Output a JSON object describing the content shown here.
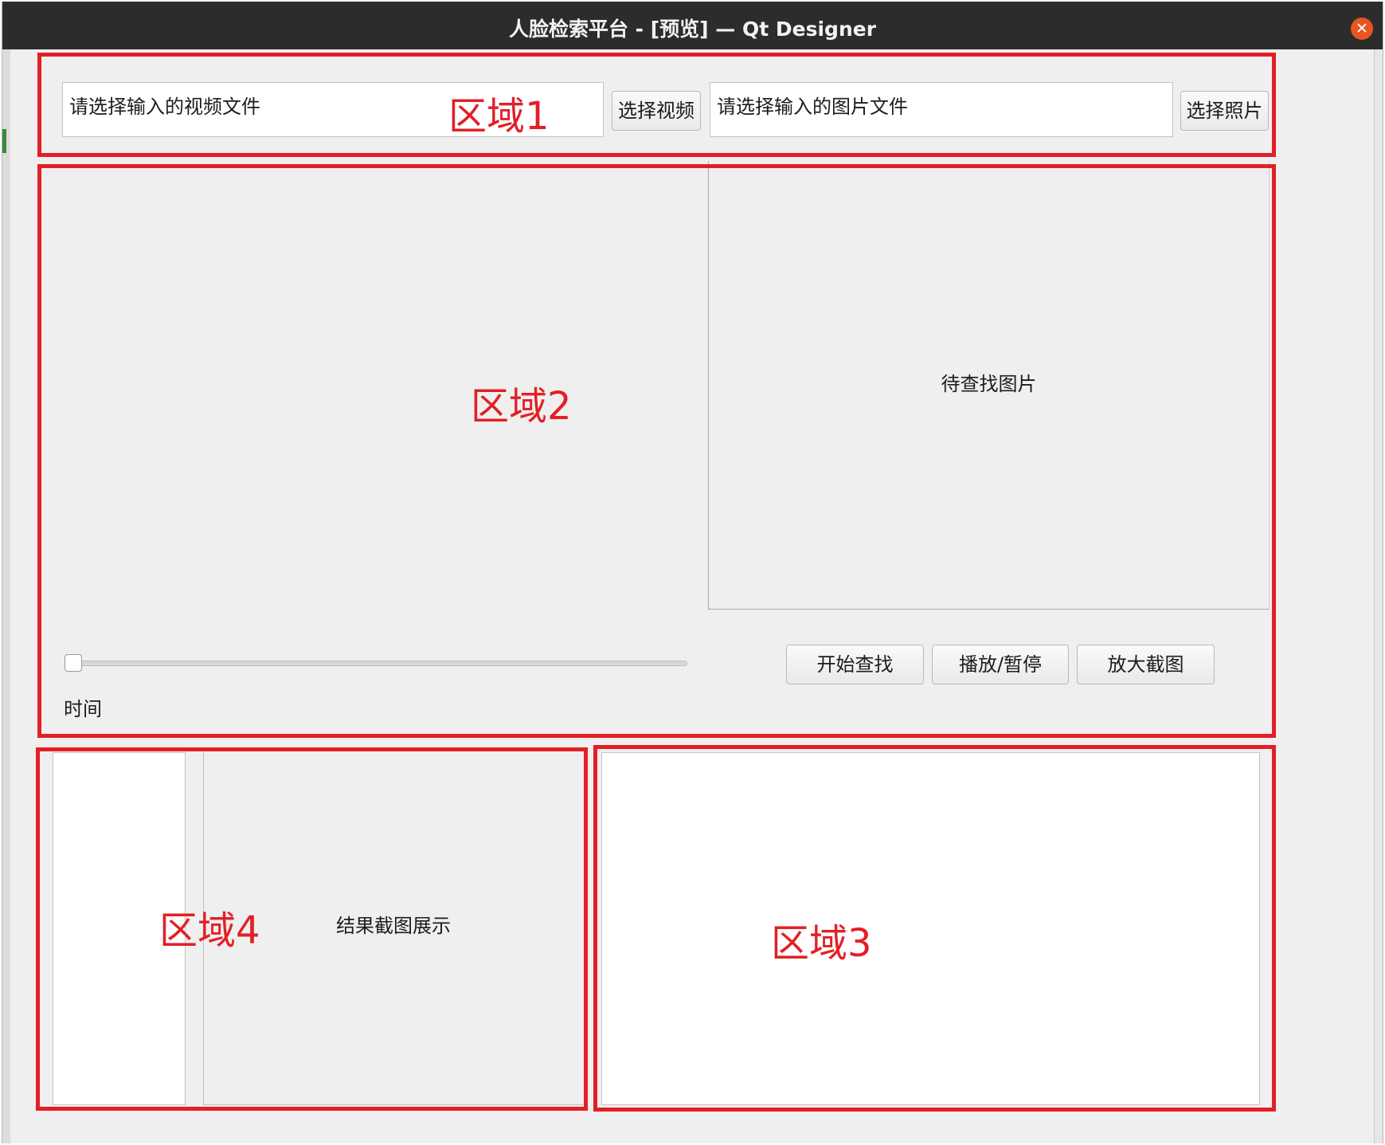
{
  "window": {
    "title": "人脸检索平台 - [预览] — Qt Designer",
    "close_glyph": "✕",
    "colors": {
      "titlebar": "#2c2c2c",
      "close": "#e95420",
      "annotation": "#e31f26"
    }
  },
  "region1": {
    "video_input": {
      "value": "请选择输入的视频文件"
    },
    "select_video_button": "选择视频",
    "image_input": {
      "value": "请选择输入的图片文件"
    },
    "select_photo_button": "选择照片"
  },
  "region2": {
    "query_image_label": "待查找图片",
    "time_label": "时间",
    "slider_value": 0,
    "buttons": {
      "start": "开始查找",
      "play_pause": "播放/暂停",
      "zoom": "放大截图"
    }
  },
  "region4": {
    "result_label": "结果截图展示"
  },
  "annotations": {
    "region1": "区域1",
    "region2": "区域2",
    "region3": "区域3",
    "region4": "区域4"
  },
  "icons": {
    "close": "close-icon"
  }
}
